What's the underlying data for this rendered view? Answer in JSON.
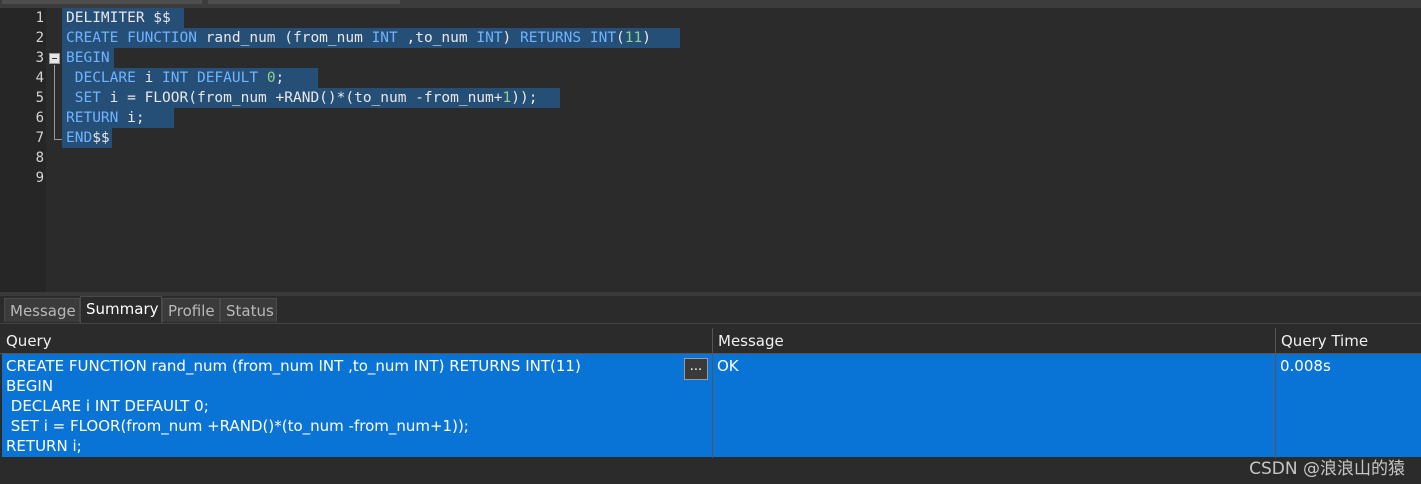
{
  "editor": {
    "line_numbers": [
      "1",
      "2",
      "3",
      "4",
      "5",
      "6",
      "7",
      "8",
      "9"
    ],
    "lines": [
      [
        {
          "t": "DELIMITER $$",
          "c": "id"
        }
      ],
      [
        {
          "t": "CREATE FUNCTION ",
          "c": "kw"
        },
        {
          "t": "rand_num (from_num ",
          "c": "id"
        },
        {
          "t": "INT",
          "c": "kw"
        },
        {
          "t": " ,to_num ",
          "c": "id"
        },
        {
          "t": "INT",
          "c": "kw"
        },
        {
          "t": ") ",
          "c": "id"
        },
        {
          "t": "RETURNS INT",
          "c": "kw"
        },
        {
          "t": "(",
          "c": "id"
        },
        {
          "t": "11",
          "c": "num"
        },
        {
          "t": ")",
          "c": "id"
        }
      ],
      [
        {
          "t": "BEGIN",
          "c": "kw"
        }
      ],
      [
        {
          "t": " DECLARE ",
          "c": "kw"
        },
        {
          "t": "i ",
          "c": "id"
        },
        {
          "t": "INT DEFAULT ",
          "c": "kw"
        },
        {
          "t": "0",
          "c": "num"
        },
        {
          "t": ";",
          "c": "id"
        }
      ],
      [
        {
          "t": " SET ",
          "c": "kw"
        },
        {
          "t": "i = FLOOR(from_num +RAND()*(to_num -from_num+",
          "c": "id"
        },
        {
          "t": "1",
          "c": "num"
        },
        {
          "t": "));",
          "c": "id"
        }
      ],
      [
        {
          "t": "RETURN ",
          "c": "kw"
        },
        {
          "t": "i;",
          "c": "id"
        }
      ],
      [
        {
          "t": "END",
          "c": "kw"
        },
        {
          "t": "$$",
          "c": "id"
        }
      ],
      [],
      []
    ]
  },
  "result_tabs": [
    "Message",
    "Summary",
    "Profile",
    "Status"
  ],
  "active_tab": "Summary",
  "grid": {
    "columns": [
      "Query",
      "Message",
      "Query Time"
    ],
    "rows": [
      {
        "query": "CREATE FUNCTION rand_num (from_num INT ,to_num INT) RETURNS INT(11)\nBEGIN\n DECLARE i INT DEFAULT 0;\n SET i = FLOOR(from_num +RAND()*(to_num -from_num+1));\nRETURN i;",
        "message": "OK",
        "query_time": "0.008s",
        "expand_label": "..."
      }
    ]
  },
  "watermark": "CSDN @浪浪山的猿",
  "colors": {
    "keyword": "#6fb3ff",
    "number": "#8fd18c",
    "selection": "#264f78",
    "row_selected": "#0a74d6"
  }
}
